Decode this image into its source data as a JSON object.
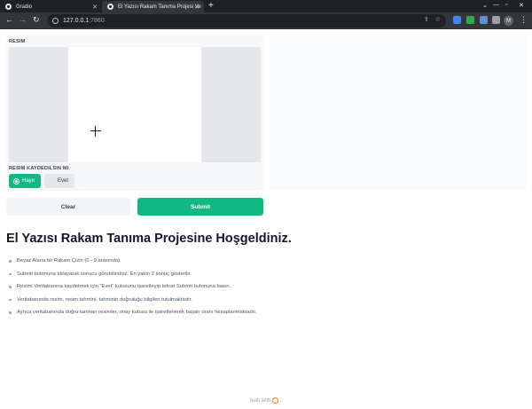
{
  "browser": {
    "tabs": [
      {
        "title": "Gradio"
      },
      {
        "title": "El Yazısı Rakam Tanıma Projesi Ve"
      }
    ],
    "url_host": "127.0.0.1",
    "url_port": ":7860",
    "profile_initial": "M"
  },
  "form": {
    "image_label": "RESIM",
    "save_label": "RESIM KAYDEDILSIN MI",
    "options": [
      {
        "label": "Hayır",
        "selected": true
      },
      {
        "label": "Evet",
        "selected": false
      }
    ],
    "clear_label": "Clear",
    "submit_label": "Submit"
  },
  "content": {
    "title": "El Yazısı Rakam Tanıma Projesine Hoşgeldiniz.",
    "bullets": [
      "Beyaz Alana bir Rakam Çizin (0 - 9 arasında).",
      "Submit butonuna tıklayarak sonucu görebilirsiniz. En yakın 2 sonuç gösterilir.",
      "Resimi Veritabanına kaydetmek için \"Evet\" kutusunu işaretleyip tekrar Submit butonuna basın.",
      "Veritabanında resim, resim tahmini, tahminin doğruluğu bilgileri tutulmaktadır.",
      "Ayrıca veritabanında doğru tanınan resimler, onay kutusu ile işaretlenerek başarı oranı hesaplanmaktadır."
    ]
  },
  "footer": {
    "text": "built with"
  },
  "colors": {
    "accent": "#10b981",
    "chrome_dark": "#202124"
  }
}
